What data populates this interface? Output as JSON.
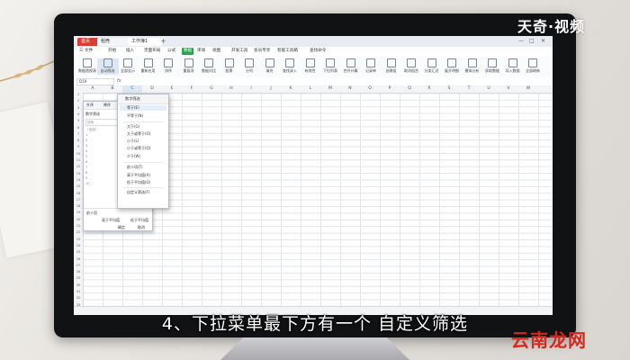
{
  "watermark": {
    "brand": "天奇·视频",
    "site": "云南龙网"
  },
  "subtitle": "4、下拉菜单最下方有一个 自定义筛选",
  "window": {
    "tabs": [
      "首页",
      "稻壳",
      "工作簿1"
    ],
    "controls": [
      "—",
      "□",
      "✕"
    ]
  },
  "menubar": {
    "items": [
      "三 文件",
      "开始",
      "插入",
      "页面布局",
      "公式",
      "数据",
      "审阅",
      "视图",
      "开发工具",
      "会员专享",
      "智能工具箱",
      "查找命令"
    ],
    "active_index": 5
  },
  "toolbar": {
    "items": [
      "数据透视表",
      "自动筛选",
      "全部显示",
      "重新应用",
      "排序",
      "重复项",
      "数据对比",
      "股票",
      "分列",
      "填充",
      "查找录入",
      "有效性",
      "下拉列表",
      "合并计算",
      "记录单",
      "创建组",
      "取消组合",
      "分类汇总",
      "展开明细",
      "模拟分析",
      "获取数据",
      "导入数据",
      "全部刷新"
    ],
    "active_index": 1
  },
  "formula": {
    "namebox": "D19",
    "fx": "fx"
  },
  "columns": [
    "A",
    "B",
    "C",
    "D",
    "E",
    "F",
    "G",
    "H",
    "I",
    "J",
    "K",
    "L",
    "M",
    "N",
    "O",
    "P",
    "Q",
    "R",
    "S",
    "T",
    "U",
    "V",
    "W"
  ],
  "selected_column": "C",
  "rows": [
    "1",
    "2",
    "3",
    "4",
    "5",
    "6",
    "7",
    "8",
    "9",
    "10",
    "11",
    "12",
    "13",
    "14",
    "15",
    "16",
    "17",
    "18",
    "19",
    "20",
    "21",
    "22",
    "23",
    "24",
    "25",
    "26",
    "27",
    "28",
    "29",
    "30",
    "31",
    "32",
    "33",
    "34"
  ],
  "filter_panel": {
    "tabs": [
      "升序",
      "降序",
      "颜色排序"
    ],
    "sub_label": "数字筛选",
    "search_placeholder": "搜索",
    "list": [
      "（全选）",
      "1",
      "2",
      "3",
      "4",
      "5",
      "6",
      "7",
      "8",
      "9",
      "10"
    ],
    "footer": {
      "before": "前十项",
      "above": "高于平均值",
      "below": "低于平均值",
      "ok": "确定",
      "cancel": "取消"
    }
  },
  "number_filter_menu": {
    "title": "数字筛选",
    "items": [
      "等于(E)",
      "不等于(N)",
      "大于(G)",
      "大于或等于(O)",
      "小于(L)",
      "小于或等于(Q)",
      "介于(W)",
      "前十项(T)",
      "高于平均值(A)",
      "低于平均值(O)",
      "自定义筛选(F)"
    ],
    "hover_index": 0
  }
}
